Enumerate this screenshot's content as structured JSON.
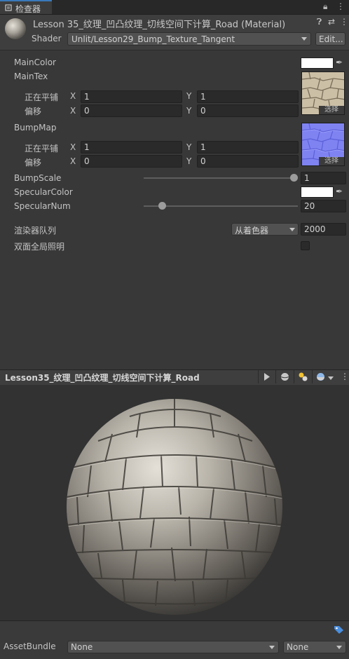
{
  "tab": {
    "title": "检查器",
    "icon": "inspector-icon",
    "lock_icon": "lock-icon",
    "menu_icon": "kebab-menu-icon"
  },
  "header": {
    "title": "Lesson 35_纹理_凹凸纹理_切线空间下计算_Road (Material)",
    "shader_label": "Shader",
    "shader_value": "Unlit/Lesson29_Bump_Texture_Tangent",
    "edit_label": "Edit...",
    "icons": [
      "help-icon",
      "preset-icon",
      "kebab-menu-icon"
    ]
  },
  "properties": {
    "main_color": {
      "label": "MainColor",
      "color": "#ffffff"
    },
    "main_tex": {
      "label": "MainTex",
      "tiling_label": "正在平铺",
      "offset_label": "偏移",
      "tiling_x": "1",
      "tiling_y": "1",
      "offset_x": "0",
      "offset_y": "0",
      "select_label": "选择"
    },
    "bump_map": {
      "label": "BumpMap",
      "tiling_label": "正在平铺",
      "offset_label": "偏移",
      "tiling_x": "1",
      "tiling_y": "1",
      "offset_x": "0",
      "offset_y": "0",
      "select_label": "选择"
    },
    "bump_scale": {
      "label": "BumpScale",
      "value": "1",
      "fraction": 1.0
    },
    "specular_color": {
      "label": "SpecularColor",
      "color": "#ffffff"
    },
    "specular_num": {
      "label": "SpecularNum",
      "value": "20",
      "fraction": 0.1
    },
    "render_queue": {
      "label": "渲染器队列",
      "dropdown": "从着色器",
      "value": "2000"
    },
    "double_sided_gi": {
      "label": "双面全局照明",
      "checked": false
    },
    "x_label": "X",
    "y_label": "Y"
  },
  "preview": {
    "title": "Lesson35_纹理_凹凸纹理_切线空间下计算_Road",
    "icons": [
      "play-icon",
      "sphere-icon",
      "light-icon",
      "background-icon",
      "kebab-menu-icon"
    ]
  },
  "asset_bundle": {
    "label": "AssetBundle",
    "name_value": "None",
    "variant_value": "None",
    "tag_icon": "tag-icon"
  }
}
